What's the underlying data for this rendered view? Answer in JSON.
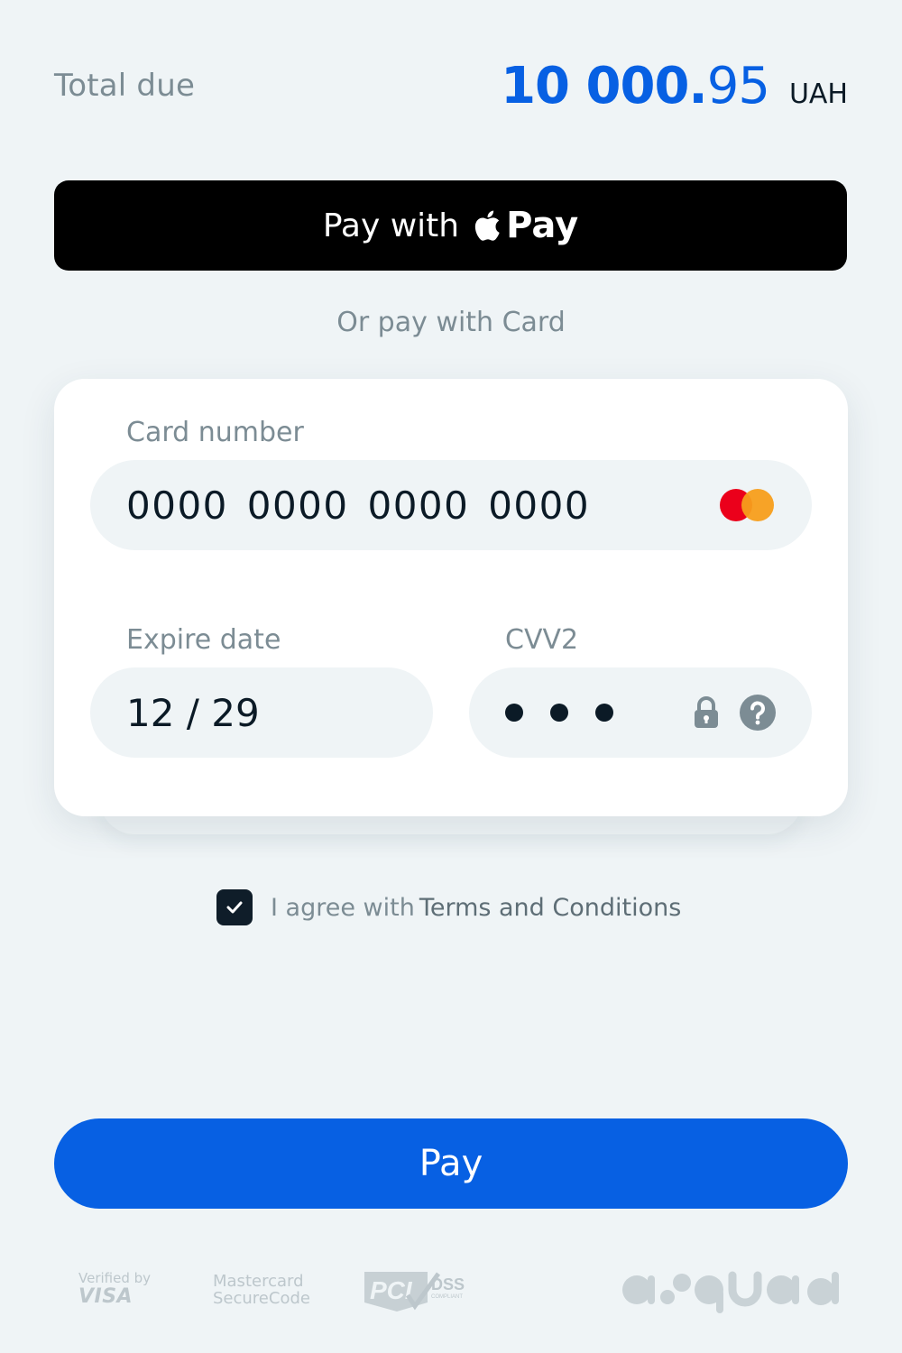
{
  "summary": {
    "total_label": "Total due",
    "amount_integer": "10 000.",
    "amount_decimal": "95",
    "currency": "UAH"
  },
  "apple_pay": {
    "prefix": "Pay with",
    "brand_word": "Pay"
  },
  "alt_method_label": "Or pay with Card",
  "card_form": {
    "card_number_label": "Card number",
    "card_number_value": "0000  0000  0000  0000",
    "card_brand_icon": "mastercard-icon",
    "expiry_label": "Expire date",
    "expiry_value": "12 / 29",
    "cvv_label": "CVV2",
    "cvv_masked_count": 3
  },
  "agreement": {
    "checked": true,
    "text": "I agree with",
    "link": "Terms and Conditions"
  },
  "pay_button_label": "Pay",
  "footer": {
    "visa_top": "Verified by",
    "visa_bottom": "VISA",
    "mc_top": "Mastercard",
    "mc_bottom": "SecureCode",
    "pci_main": "PCI",
    "pci_dss": "DSS",
    "pci_sub": "COMPLIANT",
    "brand_logo": "ipay-logo"
  },
  "colors": {
    "background": "#eff4f6",
    "accent": "#0760e3",
    "muted_text": "#7c8c94",
    "dark": "#0b1a26"
  }
}
